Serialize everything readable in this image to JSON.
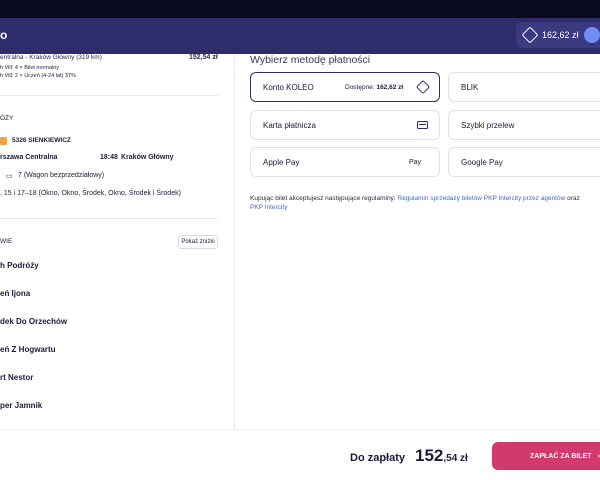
{
  "header": {
    "logo": "o",
    "wallet_balance": "162,62 zł"
  },
  "left": {
    "route_line": "entralna - Kraków Główny (319 km)",
    "route_price": "152,54 zł",
    "ticket_line1": "h Vill: 4 × Bilet normalny",
    "ticket_line2": "h Vill: 2 × Uczeń (4-24 lat) 37%",
    "section_journey": "ÓŻY",
    "train_name": "5326 SIENKIEWICZ",
    "from_station": "rszawa Centralna",
    "departure_time": "18:48",
    "to_station": "Kraków Główny",
    "carriage": "7 (Wagon bezprzedziałowy)",
    "seats": ", 15 i 17–18 (Okno, Okno, Środek, Okno, Środek i Środek)",
    "section_passengers": "WIE",
    "discount_button": "Pokaż zniżki",
    "passengers": [
      "h Podróży",
      "eń Ijona",
      "dek Do Orzechów",
      "eń Z Hogwartu",
      "rt Nestor",
      "per Jamnik"
    ]
  },
  "payment": {
    "title": "Wybierz metodę płatności",
    "konto_label": "Konto KOLEO",
    "available_label": "Dostępne:",
    "available_value": "162,62 zł",
    "blik": "BLIK",
    "card": "Karta płatnicza",
    "transfer": "Szybki przelew",
    "apple_pay": "Apple Pay",
    "apple_pay_logo": "Pay",
    "google_pay": "Google Pay",
    "terms_prefix": "Kupując bilet akceptujesz następujące regulaminy: ",
    "terms_link1": "Regulamin sprzedaży biletów PKP Intercity przez agentów",
    "terms_and": " oraz",
    "terms_link2": "PKP Intercity"
  },
  "footer": {
    "to_pay_label": "Do zapłaty",
    "amount_main": "152",
    "amount_fraction": ",54 zł",
    "pay_button": "ZAPŁAĆ ZA BILET"
  },
  "colors": {
    "header": "#2e2c6b",
    "pay_button": "#d23a6e"
  }
}
